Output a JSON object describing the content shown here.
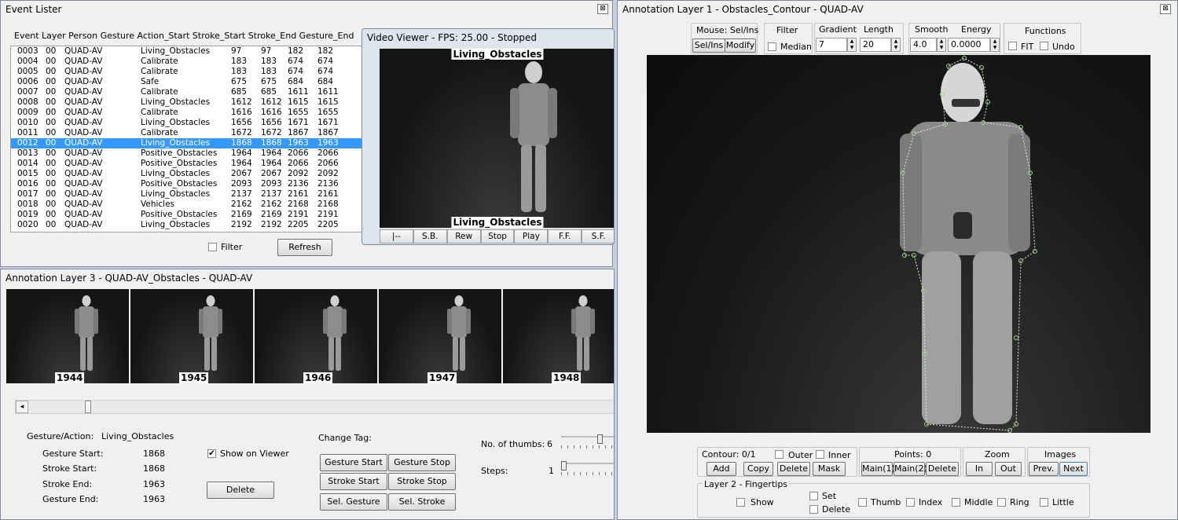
{
  "event_lister": {
    "title": "Event Lister",
    "header": "Event Layer Person Gesture Action_Start Stroke_Start Stroke_End  Gesture_End",
    "rows": [
      {
        "id": "0003",
        "layer": "00",
        "person": "QUAD-AV",
        "gesture": "Living_Obstacles",
        "a": "97",
        "b": "97",
        "c": "182",
        "d": "182"
      },
      {
        "id": "0004",
        "layer": "00",
        "person": "QUAD-AV",
        "gesture": "Calibrate",
        "a": "183",
        "b": "183",
        "c": "674",
        "d": "674"
      },
      {
        "id": "0005",
        "layer": "00",
        "person": "QUAD-AV",
        "gesture": "Calibrate",
        "a": "183",
        "b": "183",
        "c": "674",
        "d": "674"
      },
      {
        "id": "0006",
        "layer": "00",
        "person": "QUAD-AV",
        "gesture": "Safe",
        "a": "675",
        "b": "675",
        "c": "684",
        "d": "684"
      },
      {
        "id": "0007",
        "layer": "00",
        "person": "QUAD-AV",
        "gesture": "Calibrate",
        "a": "685",
        "b": "685",
        "c": "1611",
        "d": "1611"
      },
      {
        "id": "0008",
        "layer": "00",
        "person": "QUAD-AV",
        "gesture": "Living_Obstacles",
        "a": "1612",
        "b": "1612",
        "c": "1615",
        "d": "1615"
      },
      {
        "id": "0009",
        "layer": "00",
        "person": "QUAD-AV",
        "gesture": "Calibrate",
        "a": "1616",
        "b": "1616",
        "c": "1655",
        "d": "1655"
      },
      {
        "id": "0010",
        "layer": "00",
        "person": "QUAD-AV",
        "gesture": "Living_Obstacles",
        "a": "1656",
        "b": "1656",
        "c": "1671",
        "d": "1671"
      },
      {
        "id": "0011",
        "layer": "00",
        "person": "QUAD-AV",
        "gesture": "Calibrate",
        "a": "1672",
        "b": "1672",
        "c": "1867",
        "d": "1867"
      },
      {
        "id": "0012",
        "layer": "00",
        "person": "QUAD-AV",
        "gesture": "Living_Obstacles",
        "a": "1868",
        "b": "1868",
        "c": "1963",
        "d": "1963"
      },
      {
        "id": "0013",
        "layer": "00",
        "person": "QUAD-AV",
        "gesture": "Positive_Obstacles",
        "a": "1964",
        "b": "1964",
        "c": "2066",
        "d": "2066"
      },
      {
        "id": "0014",
        "layer": "00",
        "person": "QUAD-AV",
        "gesture": "Positive_Obstacles",
        "a": "1964",
        "b": "1964",
        "c": "2066",
        "d": "2066"
      },
      {
        "id": "0015",
        "layer": "00",
        "person": "QUAD-AV",
        "gesture": "Living_Obstacles",
        "a": "2067",
        "b": "2067",
        "c": "2092",
        "d": "2092"
      },
      {
        "id": "0016",
        "layer": "00",
        "person": "QUAD-AV",
        "gesture": "Positive_Obstacles",
        "a": "2093",
        "b": "2093",
        "c": "2136",
        "d": "2136"
      },
      {
        "id": "0017",
        "layer": "00",
        "person": "QUAD-AV",
        "gesture": "Living_Obstacles",
        "a": "2137",
        "b": "2137",
        "c": "2161",
        "d": "2161"
      },
      {
        "id": "0018",
        "layer": "00",
        "person": "QUAD-AV",
        "gesture": "Vehicles",
        "a": "2162",
        "b": "2162",
        "c": "2168",
        "d": "2168"
      },
      {
        "id": "0019",
        "layer": "00",
        "person": "QUAD-AV",
        "gesture": "Positive_Obstacles",
        "a": "2169",
        "b": "2169",
        "c": "2191",
        "d": "2191"
      },
      {
        "id": "0020",
        "layer": "00",
        "person": "QUAD-AV",
        "gesture": "Living_Obstacles",
        "a": "2192",
        "b": "2192",
        "c": "2205",
        "d": "2205"
      }
    ],
    "selected_id": "0012",
    "filter_label": "Filter",
    "refresh_label": "Refresh",
    "close_glyph": "⊠"
  },
  "video_viewer": {
    "title": "Video Viewer - FPS: 25.00 - Stopped",
    "top_label": "Living_Obstacles",
    "bottom_label": "Living_Obstacles",
    "controls": [
      "|--",
      "S.B.",
      "Rew",
      "Stop",
      "Play",
      "F.F.",
      "S.F."
    ]
  },
  "layer3": {
    "title": "Annotation Layer 3 - QUAD-AV_Obstacles - QUAD-AV",
    "thumbs": [
      "1944",
      "1945",
      "1946",
      "1947",
      "1948"
    ],
    "gesture_action_label": "Gesture/Action:",
    "gesture_action_value": "Living_Obstacles",
    "gesture_start_label": "Gesture Start:",
    "gesture_start_value": "1868",
    "stroke_start_label": "Stroke Start:",
    "stroke_start_value": "1868",
    "stroke_end_label": "Stroke End:",
    "stroke_end_value": "1963",
    "gesture_end_label": "Gesture End:",
    "gesture_end_value": "1963",
    "show_on_viewer_label": "Show on Viewer",
    "show_on_viewer_checked": true,
    "delete_label": "Delete",
    "change_tag_label": "Change Tag:",
    "gesture_start_btn": "Gesture Start",
    "gesture_stop_btn": "Gesture Stop",
    "stroke_start_btn": "Stroke Start",
    "stroke_stop_btn": "Stroke Stop",
    "sel_gesture_btn": "Sel. Gesture",
    "sel_stroke_btn": "Sel. Stroke",
    "num_thumbs_label": "No. of thumbs:",
    "num_thumbs_value": "6",
    "steps_label": "Steps:",
    "steps_value": "1",
    "scroll_left_glyph": "◂",
    "check_glyph": "✔"
  },
  "layer1": {
    "title": "Annotation Layer 1 - Obstacles_Contour - QUAD-AV",
    "mouse_label": "Mouse: Sel/Ins",
    "sel_ins_btn": "Sel/Ins",
    "modify_btn": "Modify",
    "filter_label": "Filter",
    "median_label": "Median",
    "gradient_label": "Gradient",
    "gradient_value": "7",
    "length_label": "Length",
    "length_value": "20",
    "smooth_label": "Smooth",
    "smooth_value": "4.0",
    "energy_label": "Energy",
    "energy_value": "0.0000",
    "functions_label": "Functions",
    "fit_label": "FIT",
    "undo_label": "Undo",
    "contour_label": "Contour: 0/1",
    "outer_label": "Outer",
    "inner_label": "Inner",
    "add_btn": "Add",
    "copy_btn": "Copy",
    "delete_btn": "Delete",
    "mask_btn": "Mask",
    "points_label": "Points: 0",
    "main1_btn": "Main(1)",
    "main2_btn": "Main(2)",
    "points_delete_btn": "Delete",
    "zoom_label": "Zoom",
    "in_btn": "In",
    "out_btn": "Out",
    "images_label": "Images",
    "prev_btn": "Prev.",
    "next_btn": "Next",
    "layer2_label": "Layer 2 - Fingertips",
    "show_label": "Show",
    "set_label": "Set",
    "delete2_label": "Delete",
    "thumb_label": "Thumb",
    "index_label": "Index",
    "middle_label": "Middle",
    "ring_label": "Ring",
    "little_label": "Little",
    "spin_up_glyph": "▲",
    "spin_down_glyph": "▼"
  }
}
